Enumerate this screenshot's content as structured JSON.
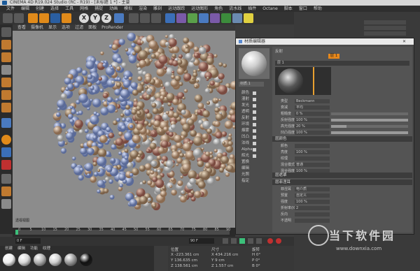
{
  "window": {
    "title": "CINEMA 4D R19.024 Studio (RC - R19) - [未标题 1 *] - 主要"
  },
  "menu": [
    "文件",
    "编辑",
    "创建",
    "选择",
    "工具",
    "网格",
    "捕捉",
    "动画",
    "模拟",
    "渲染",
    "雕刻",
    "运动跟踪",
    "运动图形",
    "角色",
    "流水线",
    "插件",
    "Octane",
    "脚本",
    "窗口",
    "帮助"
  ],
  "toolbar": {
    "axis_x": "X",
    "axis_y": "Y",
    "axis_z": "Z"
  },
  "viewport": {
    "menu": [
      "查看",
      "摄像机",
      "显示",
      "选项",
      "过滤",
      "面板",
      "ProRender"
    ],
    "axis_label": "透视视图"
  },
  "timeline": {
    "ticks": [
      "0",
      "5",
      "10",
      "15",
      "20",
      "25",
      "30",
      "35",
      "40",
      "45",
      "50",
      "55",
      "60",
      "65",
      "70",
      "75",
      "80",
      "85",
      "90"
    ],
    "frame": "0 F",
    "end": "90 F"
  },
  "material_manager": {
    "menu": [
      "创建",
      "编辑",
      "功能",
      "纹理"
    ],
    "materials": [
      "#efefef",
      "#d8d8d8",
      "#b0b0b0",
      "#cfcfcf",
      "#9a9a9a",
      "#111111"
    ]
  },
  "coordinates": {
    "headers": [
      "位置",
      "尺寸",
      "旋转"
    ],
    "rows": [
      [
        "X -223.361 cm",
        "X 434.216 cm",
        "H 0°"
      ],
      [
        "Y 136.635 cm",
        "Y 9 cm",
        "P 0°"
      ],
      [
        "Z 138.561 cm",
        "Z 1.557 cm",
        "B 0°"
      ]
    ]
  },
  "editor": {
    "title": "材质编辑器",
    "name": "材质.1",
    "channels": [
      "颜色",
      "漫射",
      "发光",
      "透明",
      "反射",
      "环境",
      "烟雾",
      "凹凸",
      "法线",
      "Alpha",
      "辉光",
      "置换",
      "编辑",
      "光照",
      "指定"
    ],
    "reflect_tab": "反射",
    "layer_label": "层 1",
    "layer_value": "层 1",
    "sections": {
      "layer": "层颜色",
      "mask": "层遮罩",
      "fresnel": "层菲涅耳"
    },
    "props": [
      {
        "label": "类型",
        "value": "Beckmann"
      },
      {
        "label": "衰减",
        "value": "平均"
      },
      {
        "label": "粗糙度",
        "value": "0 %",
        "frac": 0
      },
      {
        "label": "反射强度",
        "value": "100 %",
        "frac": 1
      },
      {
        "label": "高光强度",
        "value": "20 %",
        "frac": 0.2
      },
      {
        "label": "凹凸强度",
        "value": "100 %",
        "frac": 1
      }
    ],
    "color_props": [
      {
        "label": "颜色",
        "value": ""
      },
      {
        "label": "亮度",
        "value": "100 %"
      },
      {
        "label": "纹理",
        "value": ""
      },
      {
        "label": "混合模式",
        "value": "普通"
      },
      {
        "label": "混合强度",
        "value": "100 %"
      }
    ],
    "fresnel_props": [
      {
        "label": "菲涅耳",
        "value": "电介质"
      },
      {
        "label": "预置",
        "value": "自定义"
      },
      {
        "label": "强度",
        "value": "100 %"
      },
      {
        "label": "折射率(IOR)",
        "value": "2"
      },
      {
        "label": "反向",
        "value": ""
      },
      {
        "label": "不透明",
        "value": ""
      }
    ]
  },
  "watermark": {
    "main": "当下软件园",
    "sub": "www.downxia.com"
  }
}
